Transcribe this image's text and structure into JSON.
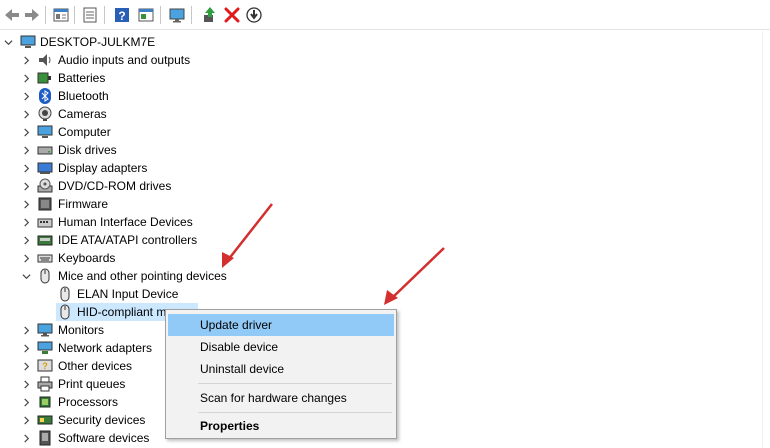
{
  "toolbar": {
    "buttons": [
      "back-icon",
      "forward-icon",
      "properties-icon",
      "document-icon",
      "help-icon",
      "console-icon",
      "monitor-icon",
      "update-driver-icon",
      "uninstall-icon",
      "download-icon"
    ]
  },
  "tree": {
    "root": "DESKTOP-JULKM7E",
    "categories": [
      "Audio inputs and outputs",
      "Batteries",
      "Bluetooth",
      "Cameras",
      "Computer",
      "Disk drives",
      "Display adapters",
      "DVD/CD-ROM drives",
      "Firmware",
      "Human Interface Devices",
      "IDE ATA/ATAPI controllers",
      "Keyboards",
      "Mice and other pointing devices"
    ],
    "mice_children": [
      "ELAN Input Device",
      "HID-compliant m"
    ],
    "categories_after": [
      "Monitors",
      "Network adapters",
      "Other devices",
      "Print queues",
      "Processors",
      "Security devices",
      "Software devices"
    ]
  },
  "context_menu": {
    "items": [
      "Update driver",
      "Disable device",
      "Uninstall device",
      "Scan for hardware changes",
      "Properties"
    ]
  },
  "colors": {
    "selection": "#cce8ff",
    "menu_highlight": "#91c9f7",
    "arrow": "#d32f2f"
  }
}
